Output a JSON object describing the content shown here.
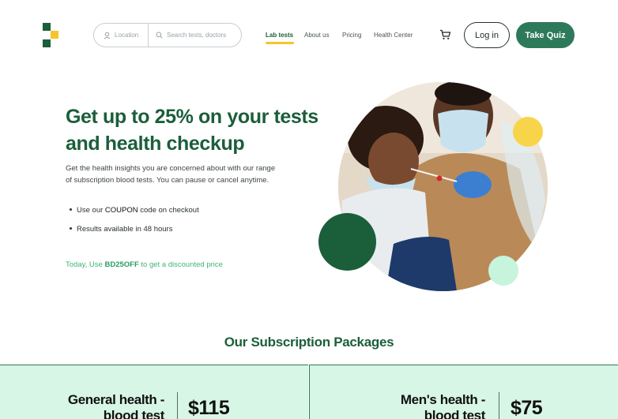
{
  "header": {
    "search": {
      "location_placeholder": "Location",
      "search_placeholder": "Search tests, doctors"
    },
    "nav": [
      {
        "label": "Lab tests",
        "active": true
      },
      {
        "label": "About us",
        "active": false
      },
      {
        "label": "Pricing",
        "active": false
      },
      {
        "label": "Health Center",
        "active": false
      }
    ],
    "login_label": "Log in",
    "quiz_label": "Take Quiz"
  },
  "hero": {
    "title": "Get up to 25% on your tests and health checkup",
    "description": "Get the health insights you are concerned about with our range of subscription blood tests. You can pause or cancel anytime.",
    "bullet_1_prefix": "Use our ",
    "bullet_1_code": "COUPON",
    "bullet_1_suffix": " code on checkout",
    "bullet_2": "Results available in 48 hours",
    "promo_prefix": "Today, Use ",
    "promo_code": "BD25OFF",
    "promo_suffix": " to get a discounted price"
  },
  "packages": {
    "title": "Our Subscription Packages",
    "items": [
      {
        "name_line1": "General health -",
        "name_line2": "blood test",
        "price": "$115"
      },
      {
        "name_line1": "Men's health -",
        "name_line2": "blood test",
        "price": "$75"
      }
    ]
  },
  "colors": {
    "primary_green": "#1b5e3a",
    "button_green": "#2d7a5b",
    "accent_yellow": "#f6c52c",
    "light_mint": "#d7f6e5",
    "promo_green": "#3fb47b"
  },
  "icons": [
    "logo-icon",
    "location-pin-icon",
    "search-icon",
    "cart-icon"
  ]
}
